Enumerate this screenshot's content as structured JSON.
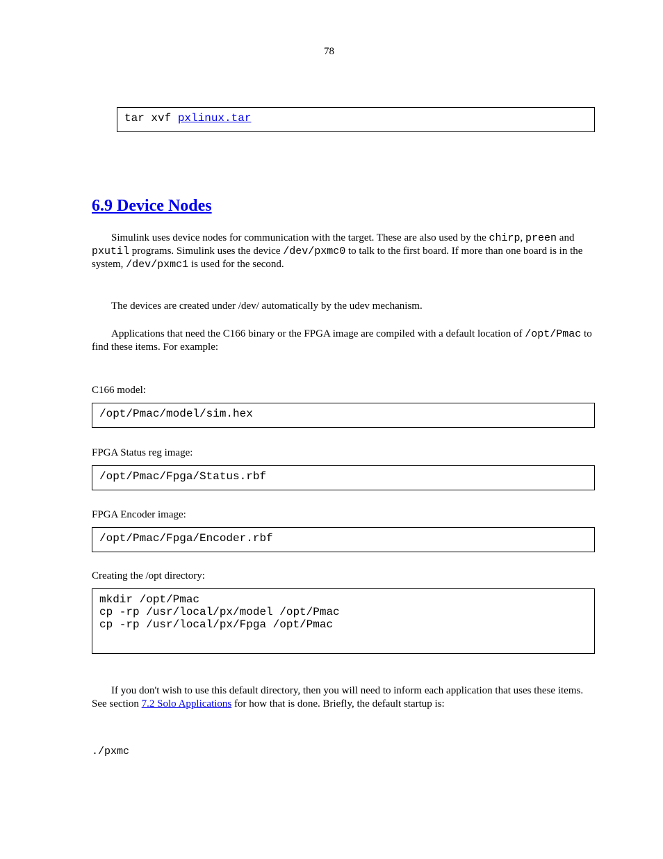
{
  "pageNumber": "78",
  "topBox": {
    "code": "tar xvf ",
    "link": "pxlinux.tar"
  },
  "heading": {
    "text": "6.9 Device Nodes"
  },
  "para1": {
    "prefix": "Simulink uses device nodes for communication with the target. These are also used by the ",
    "mono1": "chirp",
    "mid1": ", ",
    "mono2": "preen",
    "mid2": " and ",
    "mono3": "pxutil",
    "mid3": " programs. Simulink uses the device ",
    "mono4": "/dev/pxmc0",
    "mid4": " to talk to the first board. If more than one board is in the system, ",
    "mono5": "/dev/pxmc1",
    "mid5": " is used for the second."
  },
  "para2": {
    "text": "The devices are created under /dev/ automatically by the udev mechanism.",
    "lead_indent": "      "
  },
  "para3": {
    "pre": "Applications that need the C166 binary or the FPGA image are compiled with a default location of ",
    "mono": "/opt/Pmac",
    "post": " to find these items. For example:",
    "lead_indent": "      "
  },
  "labels": {
    "model": "C166 model:",
    "statusfpga": "FPGA Status reg image:",
    "encoderfpga": "FPGA Encoder image:",
    "pxdir": "Creating the /opt directory:"
  },
  "boxes": {
    "model": "/opt/Pmac/model/sim.hex",
    "statusfpga": "/opt/Pmac/Fpga/Status.rbf",
    "encoderfpga": "/opt/Pmac/Fpga/Encoder.rbf",
    "pxdir_line1": "mkdir /opt/Pmac",
    "pxdir_line2": "cp -rp /usr/local/px/model /opt/Pmac",
    "pxdir_line3": "cp -rp /usr/local/px/Fpga /opt/Pmac"
  },
  "bottom": {
    "text_pre": "If you don't wish to use this default directory, then you will need to inform each application that uses these items. See section ",
    "link": "7.2 Solo Applications",
    "text_mid": " for how that is done. Briefly, the default startup is:",
    "cmd": "./pxmc"
  }
}
